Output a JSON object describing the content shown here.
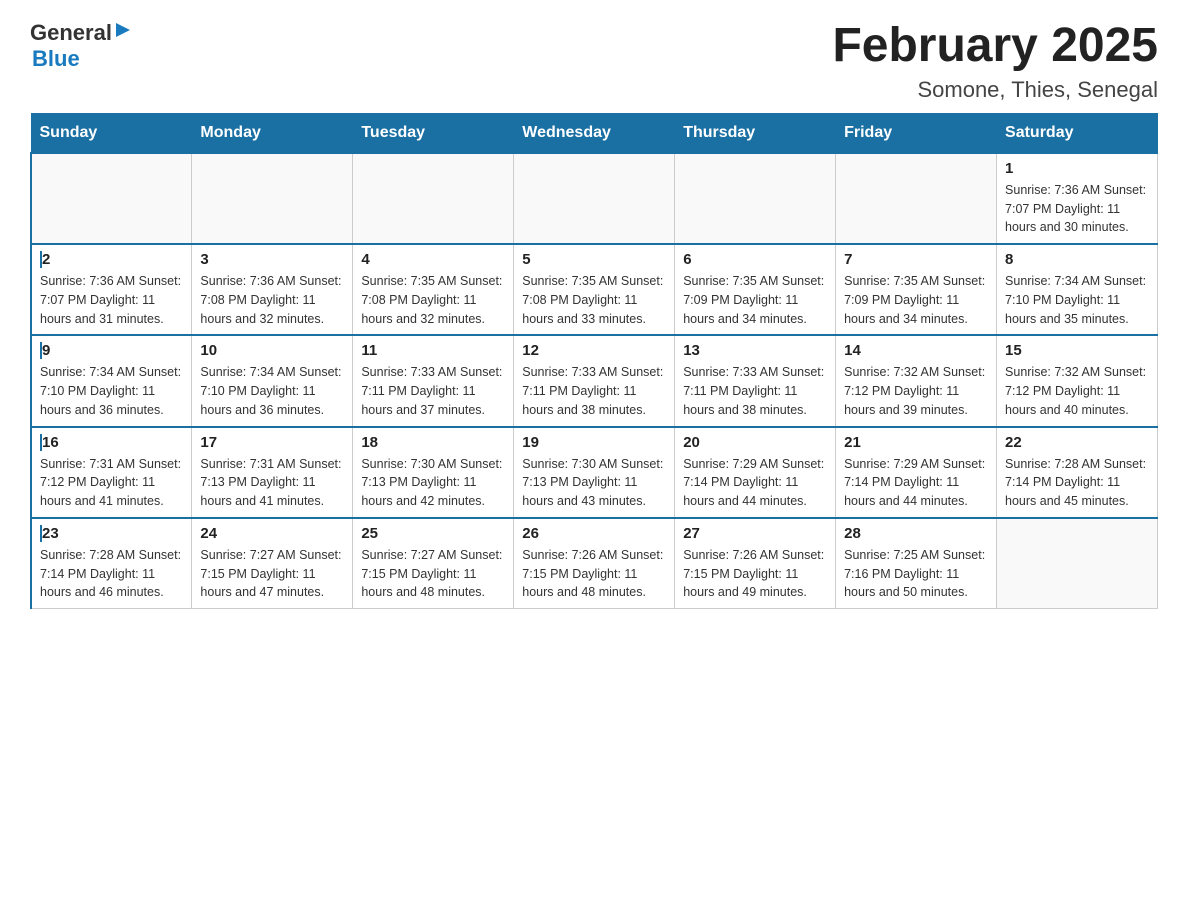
{
  "header": {
    "logo_general": "General",
    "logo_arrow": "▶",
    "logo_blue": "Blue",
    "title": "February 2025",
    "subtitle": "Somone, Thies, Senegal"
  },
  "weekdays": [
    "Sunday",
    "Monday",
    "Tuesday",
    "Wednesday",
    "Thursday",
    "Friday",
    "Saturday"
  ],
  "weeks": [
    [
      {
        "day": "",
        "info": ""
      },
      {
        "day": "",
        "info": ""
      },
      {
        "day": "",
        "info": ""
      },
      {
        "day": "",
        "info": ""
      },
      {
        "day": "",
        "info": ""
      },
      {
        "day": "",
        "info": ""
      },
      {
        "day": "1",
        "info": "Sunrise: 7:36 AM\nSunset: 7:07 PM\nDaylight: 11 hours and 30 minutes."
      }
    ],
    [
      {
        "day": "2",
        "info": "Sunrise: 7:36 AM\nSunset: 7:07 PM\nDaylight: 11 hours and 31 minutes."
      },
      {
        "day": "3",
        "info": "Sunrise: 7:36 AM\nSunset: 7:08 PM\nDaylight: 11 hours and 32 minutes."
      },
      {
        "day": "4",
        "info": "Sunrise: 7:35 AM\nSunset: 7:08 PM\nDaylight: 11 hours and 32 minutes."
      },
      {
        "day": "5",
        "info": "Sunrise: 7:35 AM\nSunset: 7:08 PM\nDaylight: 11 hours and 33 minutes."
      },
      {
        "day": "6",
        "info": "Sunrise: 7:35 AM\nSunset: 7:09 PM\nDaylight: 11 hours and 34 minutes."
      },
      {
        "day": "7",
        "info": "Sunrise: 7:35 AM\nSunset: 7:09 PM\nDaylight: 11 hours and 34 minutes."
      },
      {
        "day": "8",
        "info": "Sunrise: 7:34 AM\nSunset: 7:10 PM\nDaylight: 11 hours and 35 minutes."
      }
    ],
    [
      {
        "day": "9",
        "info": "Sunrise: 7:34 AM\nSunset: 7:10 PM\nDaylight: 11 hours and 36 minutes."
      },
      {
        "day": "10",
        "info": "Sunrise: 7:34 AM\nSunset: 7:10 PM\nDaylight: 11 hours and 36 minutes."
      },
      {
        "day": "11",
        "info": "Sunrise: 7:33 AM\nSunset: 7:11 PM\nDaylight: 11 hours and 37 minutes."
      },
      {
        "day": "12",
        "info": "Sunrise: 7:33 AM\nSunset: 7:11 PM\nDaylight: 11 hours and 38 minutes."
      },
      {
        "day": "13",
        "info": "Sunrise: 7:33 AM\nSunset: 7:11 PM\nDaylight: 11 hours and 38 minutes."
      },
      {
        "day": "14",
        "info": "Sunrise: 7:32 AM\nSunset: 7:12 PM\nDaylight: 11 hours and 39 minutes."
      },
      {
        "day": "15",
        "info": "Sunrise: 7:32 AM\nSunset: 7:12 PM\nDaylight: 11 hours and 40 minutes."
      }
    ],
    [
      {
        "day": "16",
        "info": "Sunrise: 7:31 AM\nSunset: 7:12 PM\nDaylight: 11 hours and 41 minutes."
      },
      {
        "day": "17",
        "info": "Sunrise: 7:31 AM\nSunset: 7:13 PM\nDaylight: 11 hours and 41 minutes."
      },
      {
        "day": "18",
        "info": "Sunrise: 7:30 AM\nSunset: 7:13 PM\nDaylight: 11 hours and 42 minutes."
      },
      {
        "day": "19",
        "info": "Sunrise: 7:30 AM\nSunset: 7:13 PM\nDaylight: 11 hours and 43 minutes."
      },
      {
        "day": "20",
        "info": "Sunrise: 7:29 AM\nSunset: 7:14 PM\nDaylight: 11 hours and 44 minutes."
      },
      {
        "day": "21",
        "info": "Sunrise: 7:29 AM\nSunset: 7:14 PM\nDaylight: 11 hours and 44 minutes."
      },
      {
        "day": "22",
        "info": "Sunrise: 7:28 AM\nSunset: 7:14 PM\nDaylight: 11 hours and 45 minutes."
      }
    ],
    [
      {
        "day": "23",
        "info": "Sunrise: 7:28 AM\nSunset: 7:14 PM\nDaylight: 11 hours and 46 minutes."
      },
      {
        "day": "24",
        "info": "Sunrise: 7:27 AM\nSunset: 7:15 PM\nDaylight: 11 hours and 47 minutes."
      },
      {
        "day": "25",
        "info": "Sunrise: 7:27 AM\nSunset: 7:15 PM\nDaylight: 11 hours and 48 minutes."
      },
      {
        "day": "26",
        "info": "Sunrise: 7:26 AM\nSunset: 7:15 PM\nDaylight: 11 hours and 48 minutes."
      },
      {
        "day": "27",
        "info": "Sunrise: 7:26 AM\nSunset: 7:15 PM\nDaylight: 11 hours and 49 minutes."
      },
      {
        "day": "28",
        "info": "Sunrise: 7:25 AM\nSunset: 7:16 PM\nDaylight: 11 hours and 50 minutes."
      },
      {
        "day": "",
        "info": ""
      }
    ]
  ]
}
